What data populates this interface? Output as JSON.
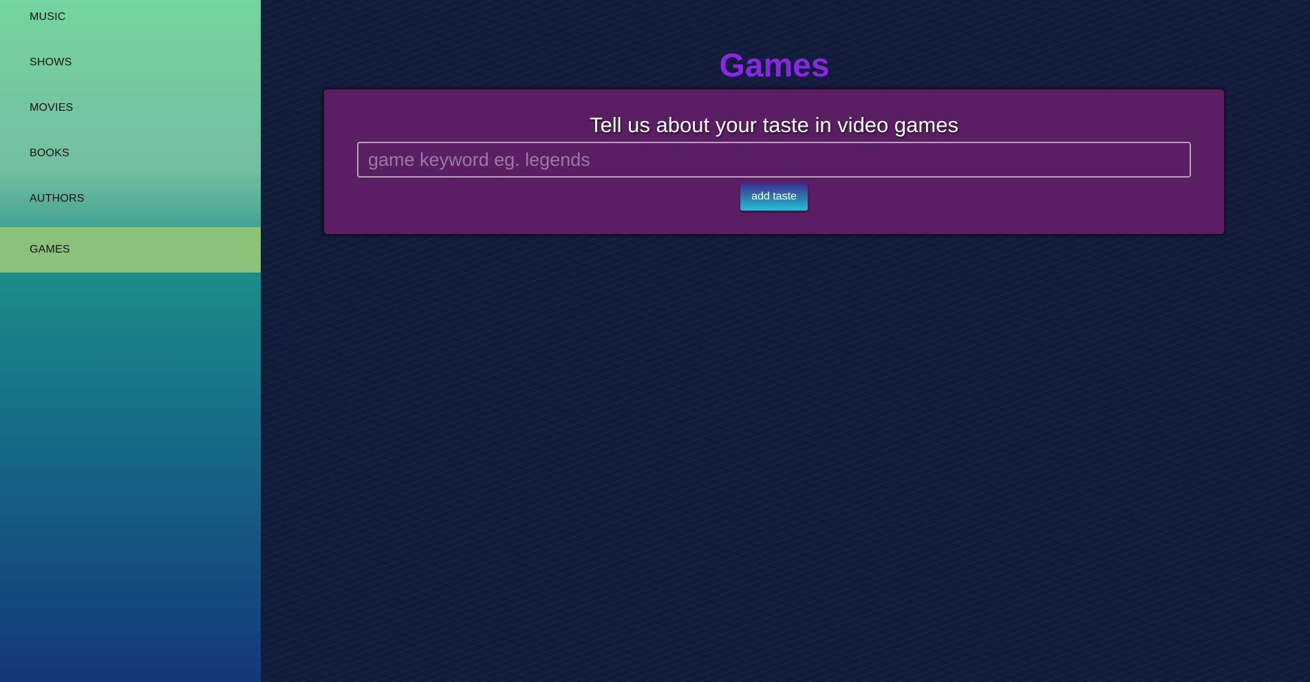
{
  "sidebar": {
    "items": [
      {
        "label": "MUSIC"
      },
      {
        "label": "SHOWS"
      },
      {
        "label": "MOVIES"
      },
      {
        "label": "BOOKS"
      },
      {
        "label": "AUTHORS"
      },
      {
        "label": "GAMES",
        "active": true
      }
    ]
  },
  "main": {
    "title": "Games",
    "panel": {
      "heading": "Tell us about your taste in video games",
      "input_placeholder": "game keyword eg. legends",
      "input_value": "",
      "button_label": "add taste"
    }
  },
  "colors": {
    "title": "#8a26e6",
    "panel_background": "#5a1e62",
    "page_background": "#121d3c",
    "active_nav": "#8bc178"
  }
}
